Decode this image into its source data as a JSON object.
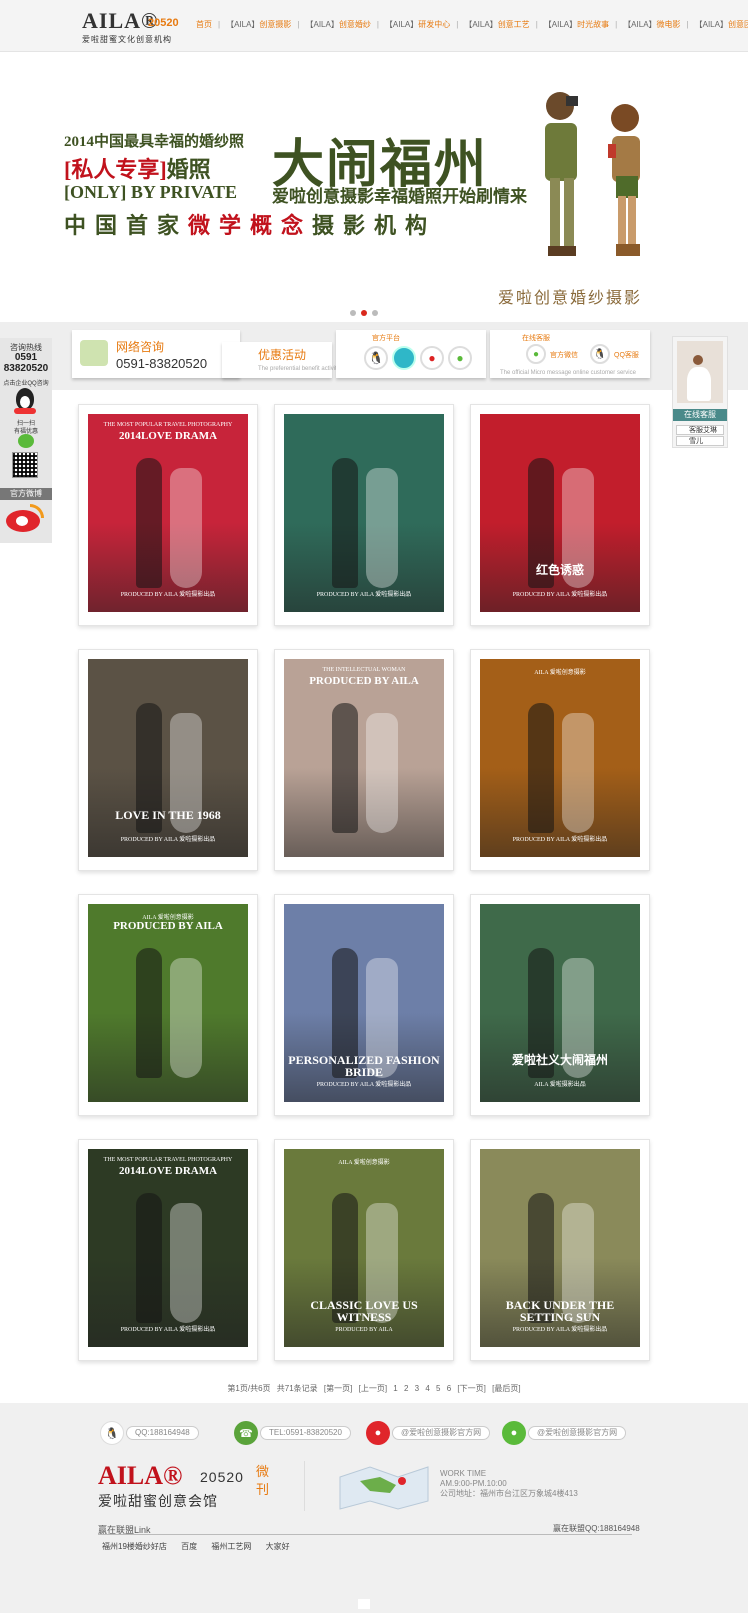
{
  "header": {
    "logo_word": "AILA®",
    "logo_num": "20520",
    "logo_sub": "爱啦甜蜜文化创意机构",
    "nav": [
      {
        "prefix": "",
        "label": "首页"
      },
      {
        "prefix": "【AILA】",
        "label": "创意摄影"
      },
      {
        "prefix": "【AILA】",
        "label": "创意婚纱"
      },
      {
        "prefix": "【AILA】",
        "label": "研发中心"
      },
      {
        "prefix": "【AILA】",
        "label": "创意工艺"
      },
      {
        "prefix": "【AILA】",
        "label": "时光故事"
      },
      {
        "prefix": "【AILA】",
        "label": "微电影"
      },
      {
        "prefix": "【AILA】",
        "label": "创意团队"
      }
    ]
  },
  "banner": {
    "line1": "2014中国最具幸福的婚纱照",
    "line2_a": "[私人专享]",
    "line2_b": "婚照",
    "line3": "[ONLY] BY PRIVATE",
    "line4_a": "中国首家",
    "line4_b": "微学概念",
    "line4_c": "摄影机构",
    "big": "大闹福州",
    "sub": "爱啦创意摄影幸福婚照开始刷情来",
    "brand": "爱啦创意婚纱摄影"
  },
  "service": {
    "consult_title": "网络咨询",
    "consult_tel": "0591-83820520",
    "promo_title": "优惠活动",
    "promo_sub": "The preferential benefit activity",
    "platform_label": "官方平台",
    "online_label": "在线客服",
    "online_sub": "The official Micro message online customer service",
    "wechat_label": "官方微信",
    "qq_label": "QQ客服"
  },
  "side_left": {
    "hotline_label": "咨询热线",
    "hotline_1": "0591",
    "hotline_2": "83820520",
    "qq_label": "点击企业QQ咨询",
    "scan_label": "扫一扫",
    "scan_sub": "有福优惠",
    "weibo_label": "官方微博"
  },
  "side_right": {
    "head": "在线客服",
    "items": [
      "客服艾琳",
      "雪儿"
    ]
  },
  "gallery": [
    {
      "top": "THE MOST POPULAR TRAVEL PHOTOGRAPHY",
      "title": "2014LOVE DRAMA",
      "caption": "",
      "producer": "PRODUCED BY AILA 爱啦摄影出品",
      "bg": "#c7243a"
    },
    {
      "top": "",
      "title": "",
      "caption": "",
      "producer": "PRODUCED BY AILA 爱啦摄影出品",
      "bg": "#2f6b5a"
    },
    {
      "top": "",
      "title": "",
      "caption": "红色诱惑",
      "producer": "PRODUCED BY AILA 爱啦摄影出品",
      "bg": "#c21e2c"
    },
    {
      "top": "",
      "title": "",
      "caption": "LOVE IN THE 1968",
      "producer": "PRODUCED BY AILA 爱啦摄影出品",
      "bg": "#5b5245"
    },
    {
      "top": "THE INTELLECTUAL WOMAN",
      "title": "PRODUCED BY AILA",
      "caption": "",
      "producer": "",
      "bg": "#b9a296"
    },
    {
      "top": "AILA 爱啦创意摄影",
      "title": "",
      "caption": "",
      "producer": "PRODUCED BY AILA 爱啦摄影出品",
      "bg": "#a45f18"
    },
    {
      "top": "AILA 爱啦创意摄影",
      "title": "PRODUCED BY AILA",
      "caption": "",
      "producer": "",
      "bg": "#4f7a2c"
    },
    {
      "top": "",
      "title": "",
      "caption": "PERSONALIZED FASHION BRIDE",
      "producer": "PRODUCED BY AILA 爱啦摄影出品",
      "bg": "#6d7fa8"
    },
    {
      "top": "",
      "title": "",
      "caption": "爱啦社义大闹福州",
      "producer": "AILA 爱啦摄影出品",
      "bg": "#3f6a4a"
    },
    {
      "top": "THE MOST POPULAR TRAVEL PHOTOGRAPHY",
      "title": "2014LOVE DRAMA",
      "caption": "",
      "producer": "PRODUCED BY AILA 爱啦摄影出品",
      "bg": "#2d3a24"
    },
    {
      "top": "AILA 爱啦创意摄影",
      "title": "",
      "caption": "CLASSIC LOVE US WITNESS",
      "producer": "PRODUCED BY AILA",
      "bg": "#6a7a3c"
    },
    {
      "top": "",
      "title": "",
      "caption": "BACK UNDER THE SETTING SUN",
      "producer": "PRODUCED BY AILA 爱啦摄影出品",
      "bg": "#8a8a5a"
    }
  ],
  "pager": {
    "info": "第1页/共6页",
    "total": "共71条记录",
    "first": "[第一页]",
    "prev": "[上一页]",
    "pages": [
      "1",
      "2",
      "3",
      "4",
      "5",
      "6"
    ],
    "next": "[下一页]",
    "last": "[最后页]"
  },
  "footer": {
    "qq": "QQ:188164948",
    "tel": "TEL:0591-83820520",
    "weibo": "@爱啦创意摄影官方网",
    "wechat": "@爱啦创意摄影官方网",
    "logo_word": "AILA®",
    "logo_num": "20520",
    "logo_sub": "爱啦甜蜜创意会馆",
    "wk": "微刊",
    "work_title": "WORK TIME",
    "work_hours": "AM.9:00-PM.10:00",
    "address": "公司地址：福州市台江区万象城4楼413",
    "links_title": "赢在联盟Link",
    "links_qq": "赢在联盟QQ:188164948",
    "links": [
      "福州19楼婚纱好店",
      "百度",
      "福州工艺网",
      "大家好"
    ]
  },
  "colors": {
    "accent": "#e77b12",
    "brand_red": "#c1121c",
    "banner_green": "#3e5222"
  }
}
